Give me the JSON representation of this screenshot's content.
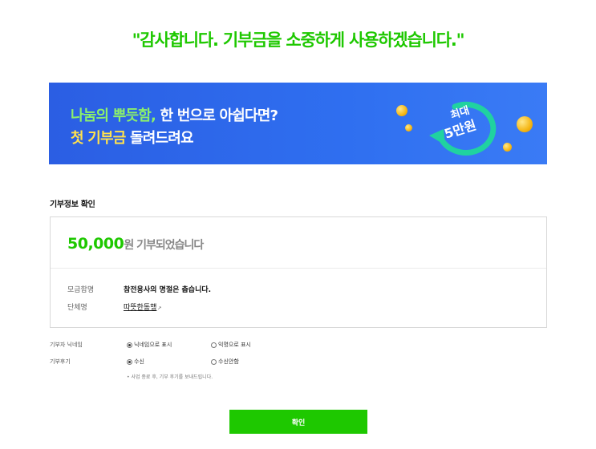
{
  "headline": "\"감사합니다. 기부금을 소중하게 사용하겠습니다.\"",
  "banner": {
    "line1_highlight": "나눔의 뿌듯함,",
    "line1_rest": " 한 번으로 아쉽다면?",
    "line2_highlight": "첫 기부금",
    "line2_rest": " 돌려드려요",
    "badge_line1": "최대",
    "badge_line2": "5만원"
  },
  "section_title": "기부정보 확인",
  "donation": {
    "amount": "50,000",
    "amount_suffix": "원 기부되었습니다",
    "fundraiser_label": "모금함명",
    "fundraiser_value": "참전용사의 명절은 춥습니다.",
    "group_label": "단체명",
    "group_value": "따뜻한동행",
    "group_marker": "↗"
  },
  "options": {
    "nickname": {
      "label": "기부자 닉네임",
      "choices": [
        "닉네임으로 표시",
        "익명으로 표시"
      ],
      "selected": 0
    },
    "postscript": {
      "label": "기부후기",
      "choices": [
        "수신",
        "수신안함"
      ],
      "selected": 0
    },
    "notice": "• 사업 종료 후, 기부 후기를 보내드립니다."
  },
  "confirm_label": "확인",
  "colors": {
    "accent": "#1ec800",
    "banner_blue": "#2f6ff0",
    "highlight_green": "#8cf06b",
    "highlight_yellow": "#ffe14d",
    "coin": "#f5b614"
  }
}
